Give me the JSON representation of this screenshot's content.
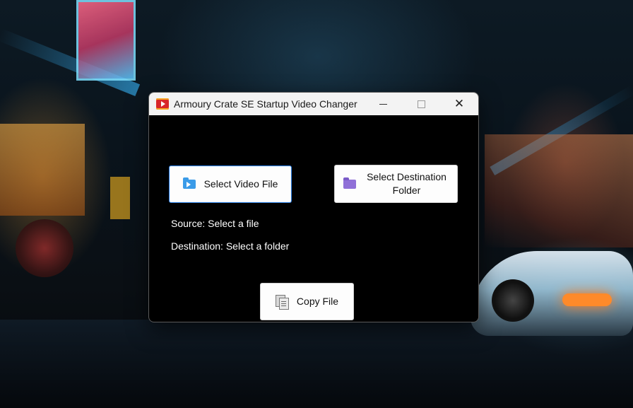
{
  "window": {
    "title": "Armoury Crate SE Startup Video Changer",
    "icon": "film-play-icon",
    "controls": {
      "minimize_icon": "minimize-icon",
      "maximize_icon": "maximize-icon",
      "close_glyph": "✕"
    }
  },
  "buttons": {
    "select_video": {
      "label": "Select Video File",
      "icon": "video-folder-icon",
      "focused": true
    },
    "select_destination": {
      "label": "Select Destination Folder",
      "icon": "folder-icon"
    },
    "copy": {
      "label": "Copy File",
      "icon": "copy-icon"
    }
  },
  "status": {
    "source": "Source: Select a file",
    "destination": "Destination: Select a folder"
  },
  "colors": {
    "window_background": "#000000",
    "titlebar": "#f3f3f3",
    "button_background": "#fdfdfd",
    "focus_border": "#2b7de0",
    "text_on_dark": "#ffffff"
  },
  "background": "cyberpunk-city-wallpaper"
}
